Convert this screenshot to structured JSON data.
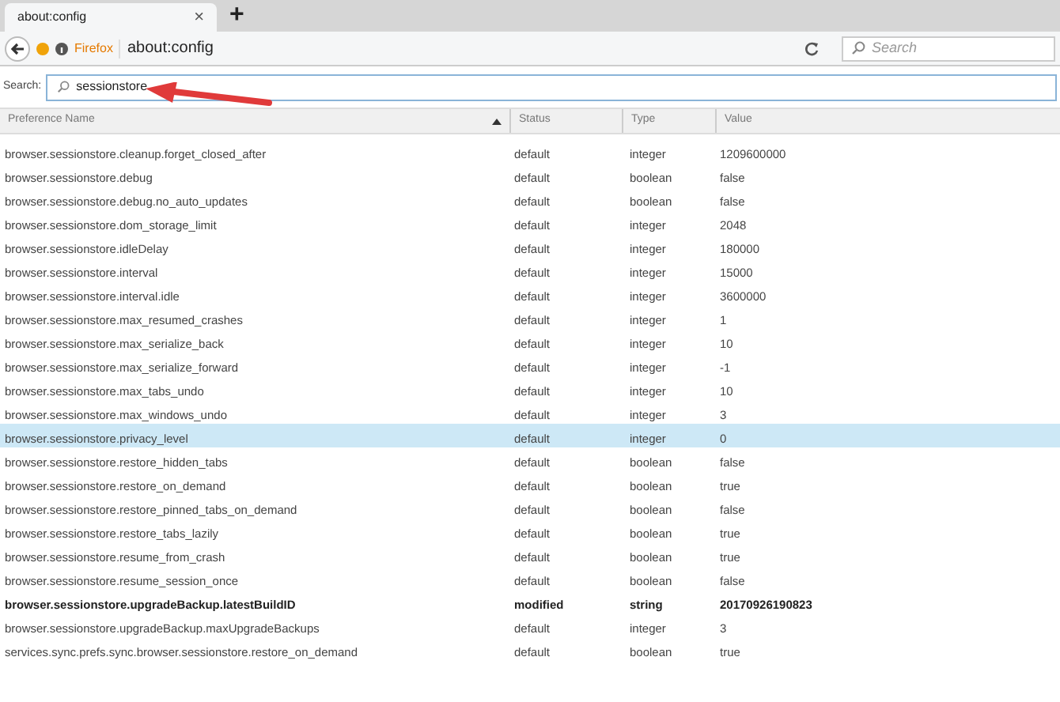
{
  "tab": {
    "title": "about:config",
    "close": "×",
    "new_tab": "+"
  },
  "nav": {
    "identity": "Firefox",
    "url": "about:config",
    "search_placeholder": "Search"
  },
  "filter": {
    "label": "Search:",
    "value": "sessionstore"
  },
  "table": {
    "columns": [
      {
        "label": "Preference Name",
        "sorted": true
      },
      {
        "label": "Status",
        "sorted": false
      },
      {
        "label": "Type",
        "sorted": false
      },
      {
        "label": "Value",
        "sorted": false
      }
    ],
    "rows": [
      {
        "name": "browser.sessionstore.cleanup.forget_closed_after",
        "status": "default",
        "type": "integer",
        "value": "1209600000",
        "selected": false,
        "modified": false
      },
      {
        "name": "browser.sessionstore.debug",
        "status": "default",
        "type": "boolean",
        "value": "false",
        "selected": false,
        "modified": false
      },
      {
        "name": "browser.sessionstore.debug.no_auto_updates",
        "status": "default",
        "type": "boolean",
        "value": "false",
        "selected": false,
        "modified": false
      },
      {
        "name": "browser.sessionstore.dom_storage_limit",
        "status": "default",
        "type": "integer",
        "value": "2048",
        "selected": false,
        "modified": false
      },
      {
        "name": "browser.sessionstore.idleDelay",
        "status": "default",
        "type": "integer",
        "value": "180000",
        "selected": false,
        "modified": false
      },
      {
        "name": "browser.sessionstore.interval",
        "status": "default",
        "type": "integer",
        "value": "15000",
        "selected": false,
        "modified": false
      },
      {
        "name": "browser.sessionstore.interval.idle",
        "status": "default",
        "type": "integer",
        "value": "3600000",
        "selected": false,
        "modified": false
      },
      {
        "name": "browser.sessionstore.max_resumed_crashes",
        "status": "default",
        "type": "integer",
        "value": "1",
        "selected": false,
        "modified": false
      },
      {
        "name": "browser.sessionstore.max_serialize_back",
        "status": "default",
        "type": "integer",
        "value": "10",
        "selected": false,
        "modified": false
      },
      {
        "name": "browser.sessionstore.max_serialize_forward",
        "status": "default",
        "type": "integer",
        "value": "-1",
        "selected": false,
        "modified": false
      },
      {
        "name": "browser.sessionstore.max_tabs_undo",
        "status": "default",
        "type": "integer",
        "value": "10",
        "selected": false,
        "modified": false
      },
      {
        "name": "browser.sessionstore.max_windows_undo",
        "status": "default",
        "type": "integer",
        "value": "3",
        "selected": false,
        "modified": false
      },
      {
        "name": "browser.sessionstore.privacy_level",
        "status": "default",
        "type": "integer",
        "value": "0",
        "selected": true,
        "modified": false
      },
      {
        "name": "browser.sessionstore.restore_hidden_tabs",
        "status": "default",
        "type": "boolean",
        "value": "false",
        "selected": false,
        "modified": false
      },
      {
        "name": "browser.sessionstore.restore_on_demand",
        "status": "default",
        "type": "boolean",
        "value": "true",
        "selected": false,
        "modified": false
      },
      {
        "name": "browser.sessionstore.restore_pinned_tabs_on_demand",
        "status": "default",
        "type": "boolean",
        "value": "false",
        "selected": false,
        "modified": false
      },
      {
        "name": "browser.sessionstore.restore_tabs_lazily",
        "status": "default",
        "type": "boolean",
        "value": "true",
        "selected": false,
        "modified": false
      },
      {
        "name": "browser.sessionstore.resume_from_crash",
        "status": "default",
        "type": "boolean",
        "value": "true",
        "selected": false,
        "modified": false
      },
      {
        "name": "browser.sessionstore.resume_session_once",
        "status": "default",
        "type": "boolean",
        "value": "false",
        "selected": false,
        "modified": false
      },
      {
        "name": "browser.sessionstore.upgradeBackup.latestBuildID",
        "status": "modified",
        "type": "string",
        "value": "20170926190823",
        "selected": false,
        "modified": true
      },
      {
        "name": "browser.sessionstore.upgradeBackup.maxUpgradeBackups",
        "status": "default",
        "type": "integer",
        "value": "3",
        "selected": false,
        "modified": false
      },
      {
        "name": "services.sync.prefs.sync.browser.sessionstore.restore_on_demand",
        "status": "default",
        "type": "boolean",
        "value": "true",
        "selected": false,
        "modified": false
      }
    ]
  }
}
